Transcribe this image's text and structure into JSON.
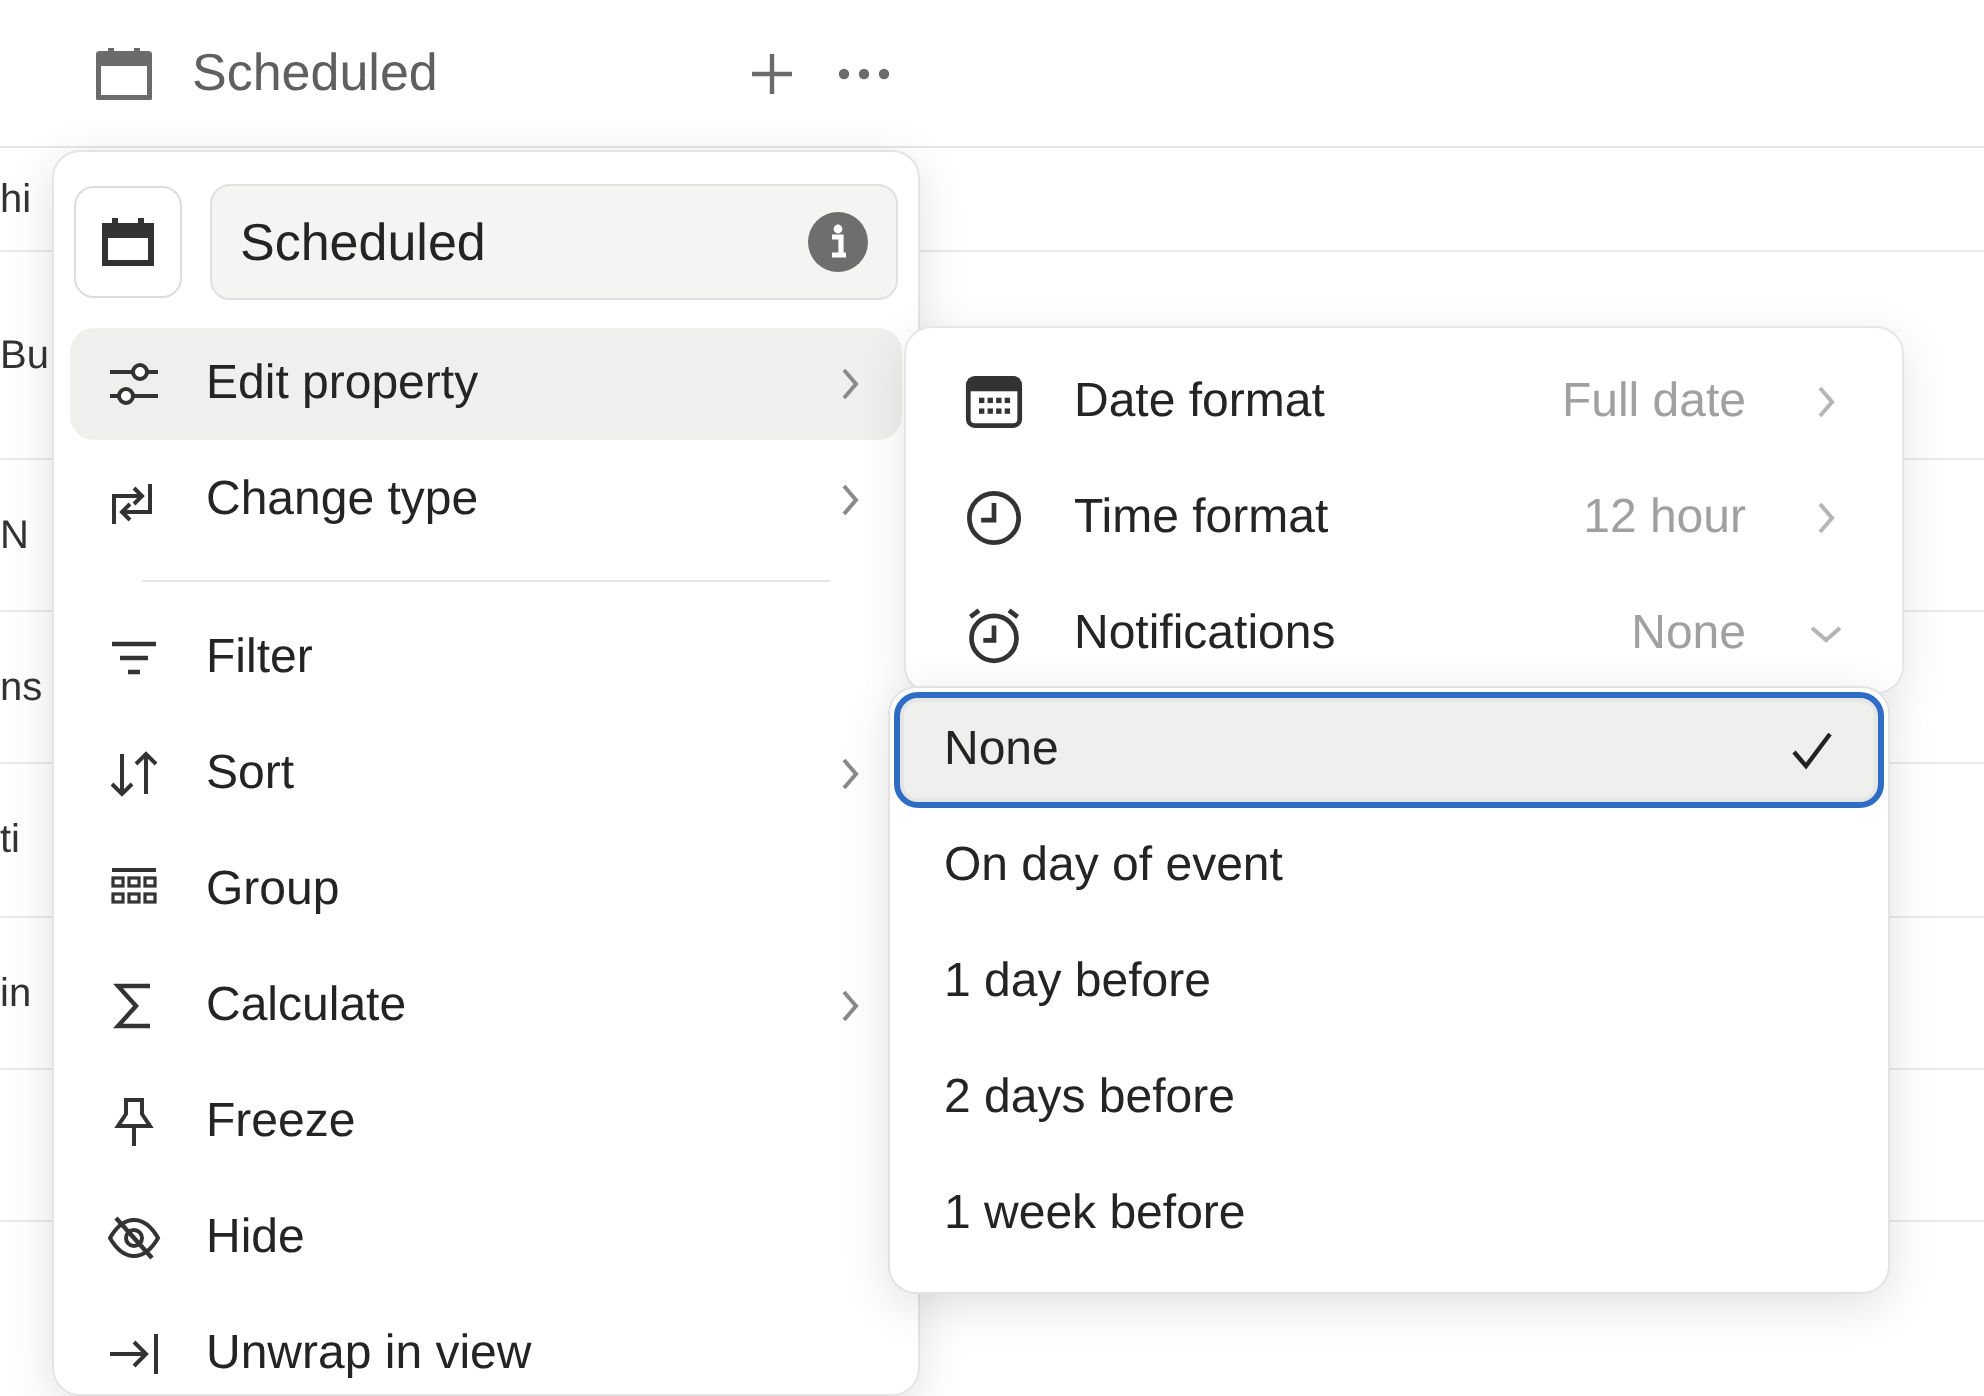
{
  "header": {
    "title": "Scheduled"
  },
  "rows": [
    {
      "text": "hi"
    },
    {
      "text": "Bu"
    },
    {
      "text": "N"
    },
    {
      "text": "ns"
    },
    {
      "text": "ti"
    },
    {
      "text": "in"
    }
  ],
  "menu": {
    "name_value": "Scheduled",
    "items": [
      {
        "kind": "edit",
        "label": "Edit property",
        "submenu": true,
        "selected": true
      },
      {
        "kind": "change",
        "label": "Change type",
        "submenu": true,
        "selected": false
      },
      {
        "kind": "divider"
      },
      {
        "kind": "filter",
        "label": "Filter",
        "submenu": false,
        "selected": false
      },
      {
        "kind": "sort",
        "label": "Sort",
        "submenu": true,
        "selected": false
      },
      {
        "kind": "group",
        "label": "Group",
        "submenu": false,
        "selected": false
      },
      {
        "kind": "calculate",
        "label": "Calculate",
        "submenu": true,
        "selected": false
      },
      {
        "kind": "freeze",
        "label": "Freeze",
        "submenu": false,
        "selected": false
      },
      {
        "kind": "hide",
        "label": "Hide",
        "submenu": false,
        "selected": false
      },
      {
        "kind": "unwrap",
        "label": "Unwrap in view",
        "submenu": false,
        "selected": false
      }
    ]
  },
  "property_menu": {
    "items": [
      {
        "kind": "date",
        "label": "Date format",
        "value": "Full date",
        "expanded": false
      },
      {
        "kind": "time",
        "label": "Time format",
        "value": "12 hour",
        "expanded": false
      },
      {
        "kind": "alarm",
        "label": "Notifications",
        "value": "None",
        "expanded": true
      }
    ]
  },
  "notification_options": [
    {
      "label": "None",
      "selected": true
    },
    {
      "label": "On day of event",
      "selected": false
    },
    {
      "label": "1 day before",
      "selected": false
    },
    {
      "label": "2 days before",
      "selected": false
    },
    {
      "label": "1 week before",
      "selected": false
    }
  ]
}
